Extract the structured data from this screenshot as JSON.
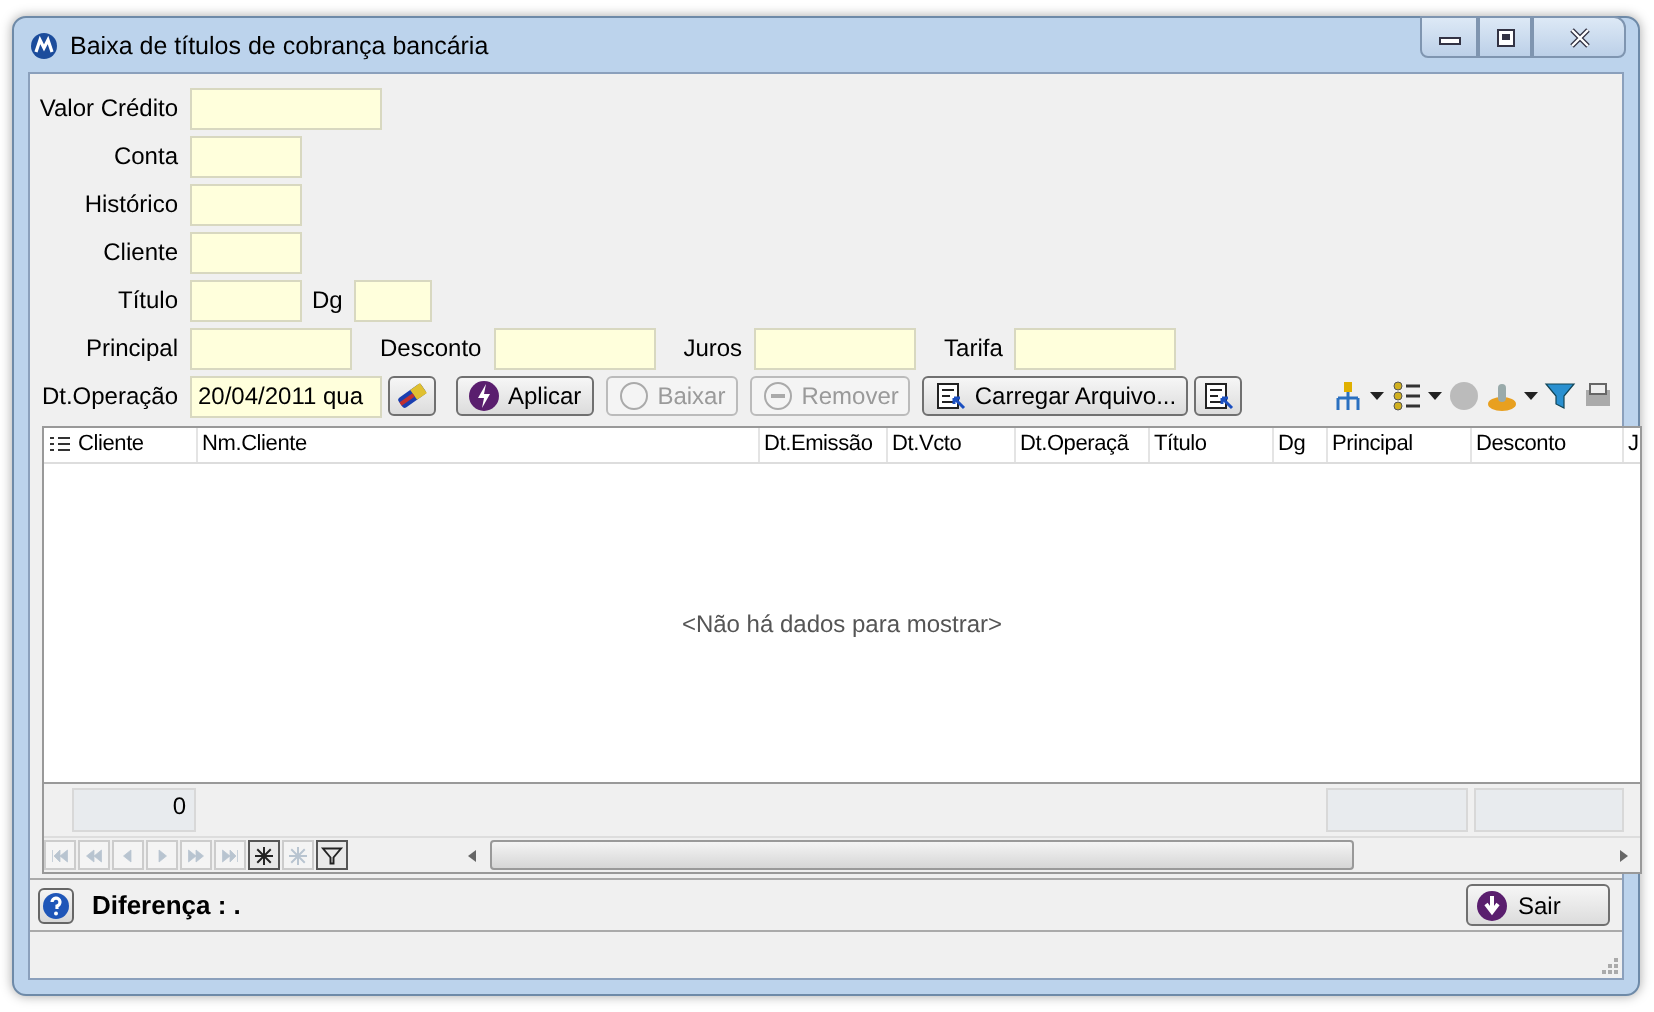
{
  "window": {
    "title": "Baixa de títulos de cobrança bancária"
  },
  "form": {
    "rows": [
      {
        "fields": [
          {
            "label": "Valor Crédito"
          }
        ]
      },
      {
        "fields": [
          {
            "label": "Conta"
          }
        ]
      },
      {
        "fields": [
          {
            "label": "Histórico"
          }
        ]
      },
      {
        "fields": [
          {
            "label": "Cliente"
          }
        ]
      },
      {
        "fields": [
          {
            "label": "Título"
          },
          {
            "label": "Dg"
          }
        ]
      },
      {
        "fields": [
          {
            "label": "Principal"
          },
          {
            "label": "Desconto"
          },
          {
            "label": "Juros"
          },
          {
            "label": "Tarifa"
          }
        ]
      },
      {
        "fields": [
          {
            "label": "Dt.Operação",
            "value": "20/04/2011 qua"
          }
        ]
      }
    ]
  },
  "actions": [
    {
      "kind": "eraser",
      "disabled": false
    },
    {
      "kind": "apply",
      "label": "Aplicar",
      "disabled": false
    },
    {
      "kind": "circle",
      "label": "Baixar",
      "disabled": true
    },
    {
      "kind": "minus",
      "label": "Remover",
      "disabled": true
    },
    {
      "kind": "load",
      "label": "Carregar Arquivo...",
      "disabled": false
    },
    {
      "kind": "load",
      "disabled": false
    }
  ],
  "toolbar": [
    {
      "kind": "tree",
      "dropdown": true
    },
    {
      "kind": "list",
      "dropdown": true
    },
    {
      "kind": "dot",
      "dropdown": false
    },
    {
      "kind": "joystick",
      "dropdown": true
    },
    {
      "kind": "funnel",
      "dropdown": false
    },
    {
      "kind": "printer",
      "dropdown": false
    }
  ],
  "table": {
    "columns": [
      "Cliente",
      "Nm.Cliente",
      "Dt.Emissão",
      "Dt.Vcto",
      "Dt.Operaçã",
      "Título",
      "Dg",
      "Principal",
      "Desconto",
      "J"
    ],
    "empty_message": "<Não há dados para mostrar>",
    "footer": {
      "count": "0"
    }
  },
  "navigator": [
    {
      "kind": "first",
      "disabled": true
    },
    {
      "kind": "prevpage",
      "disabled": true
    },
    {
      "kind": "prev",
      "disabled": true
    },
    {
      "kind": "next",
      "disabled": true
    },
    {
      "kind": "nextpage",
      "disabled": true
    },
    {
      "kind": "last",
      "disabled": true
    },
    {
      "kind": "insert",
      "disabled": false
    },
    {
      "kind": "append",
      "disabled": true
    },
    {
      "kind": "filter",
      "disabled": false
    }
  ],
  "summary": {
    "text": "Diferença : ."
  },
  "exit_button": {
    "label": "Sair"
  }
}
